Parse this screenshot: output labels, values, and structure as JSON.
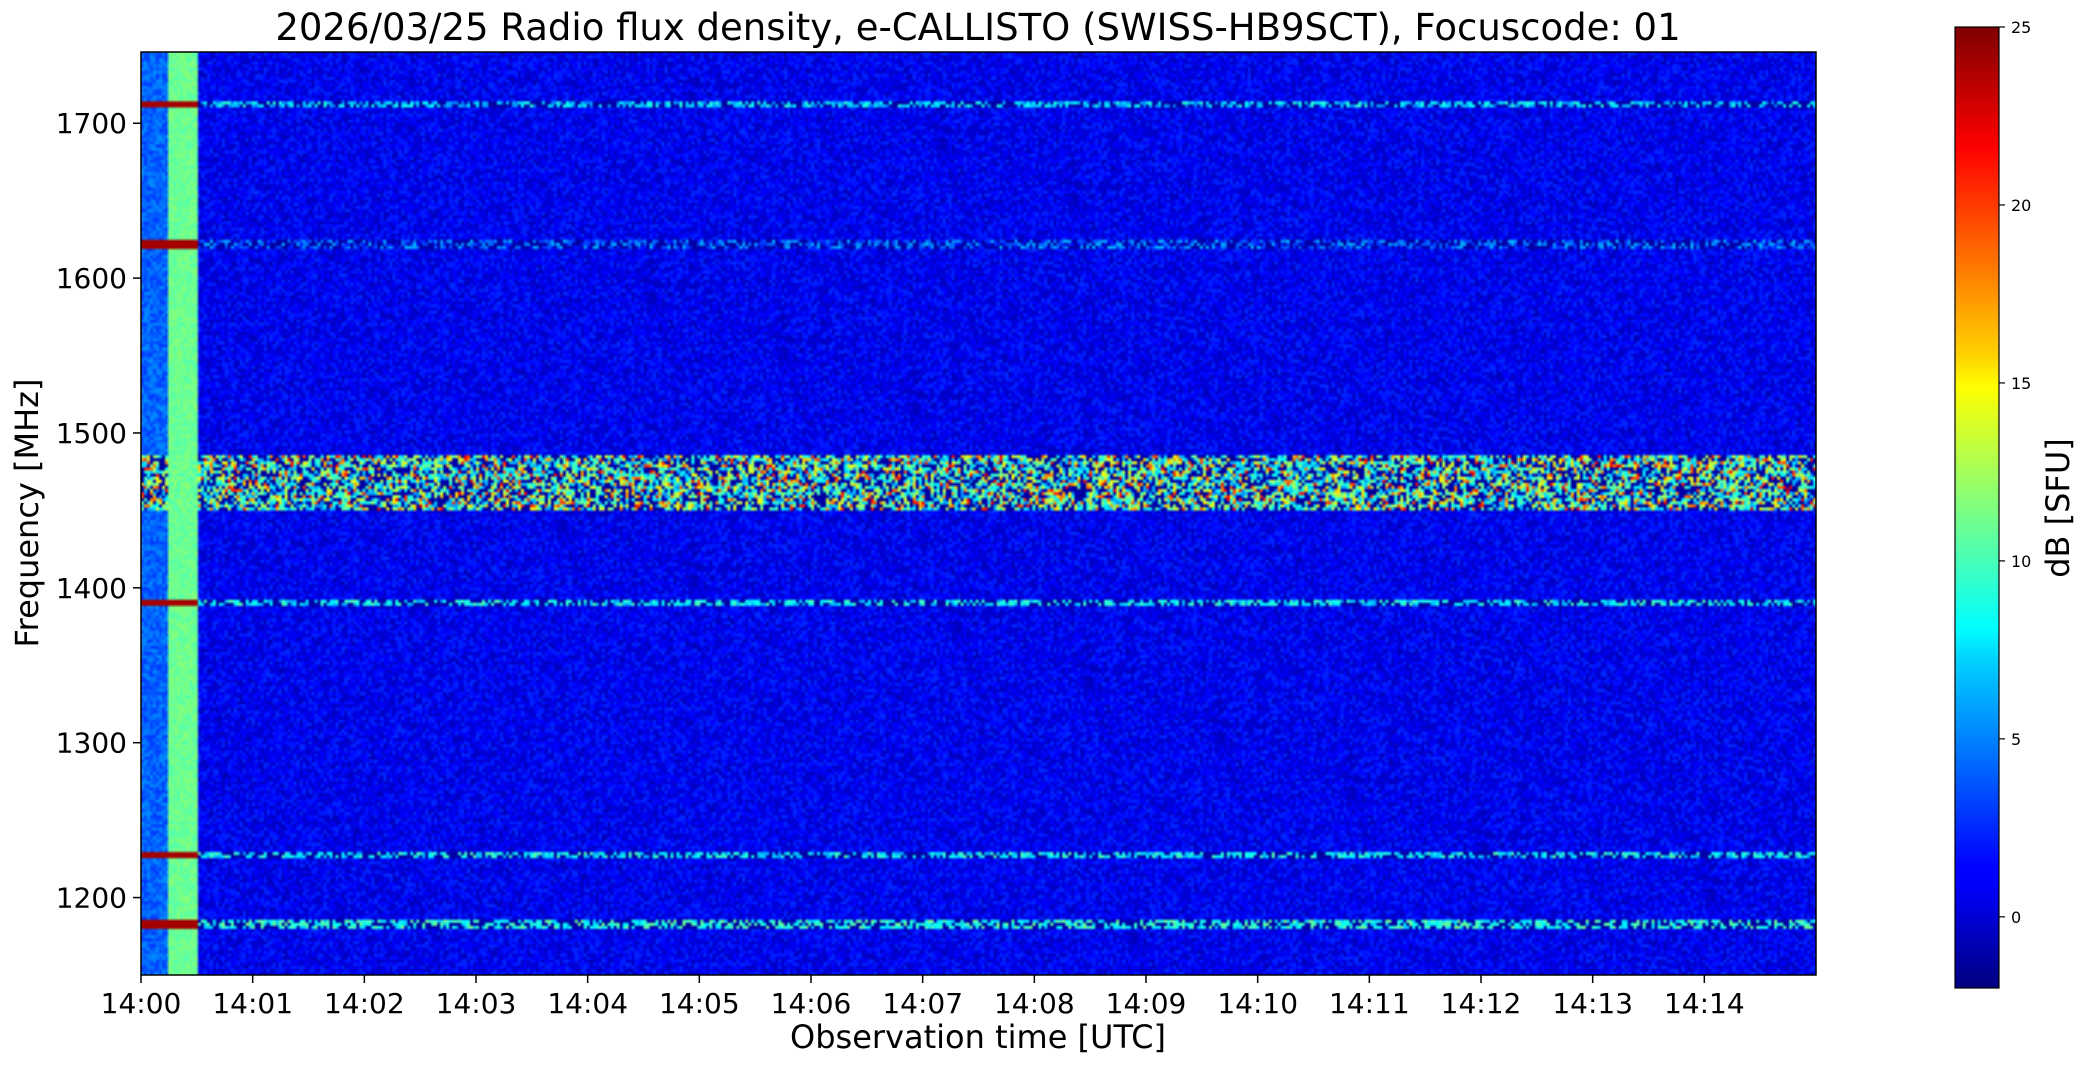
{
  "chart_data": {
    "type": "heatmap",
    "title": "2026/03/25  Radio flux density, e-CALLISTO (SWISS-HB9SCT), Focuscode: 01",
    "xlabel": "Observation time [UTC]",
    "ylabel": "Frequency [MHz]",
    "colorbar_label": "dB [SFU]",
    "colormap": "jet",
    "x_ticks": [
      "14:00",
      "14:01",
      "14:02",
      "14:03",
      "14:04",
      "14:05",
      "14:06",
      "14:07",
      "14:08",
      "14:09",
      "14:10",
      "14:11",
      "14:12",
      "14:13",
      "14:14"
    ],
    "xlim_minutes": [
      0,
      15
    ],
    "y_ticks": [
      1200,
      1300,
      1400,
      1500,
      1600,
      1700
    ],
    "ylim": [
      1150,
      1746
    ],
    "colorbar_ticks": [
      0,
      5,
      10,
      15,
      20,
      25
    ],
    "clim": [
      -2,
      25
    ],
    "background_level_db": 1,
    "features": [
      {
        "kind": "calibration_column",
        "t_start_min": 0.25,
        "t_end_min": 0.5,
        "level_db": 11
      },
      {
        "kind": "noise_column",
        "t_start_min": 0.0,
        "t_end_min": 0.25,
        "level_db": 4
      },
      {
        "kind": "band",
        "freq_low": 1450,
        "freq_high": 1485,
        "level_db": 12
      },
      {
        "kind": "line",
        "freq": 1712,
        "level_db": 6
      },
      {
        "kind": "line",
        "freq": 1390,
        "level_db": 7
      },
      {
        "kind": "line",
        "freq": 1227,
        "level_db": 7
      },
      {
        "kind": "line",
        "freq": 1183,
        "level_db": 8
      },
      {
        "kind": "line",
        "freq": 1622,
        "level_db": 3
      }
    ]
  }
}
